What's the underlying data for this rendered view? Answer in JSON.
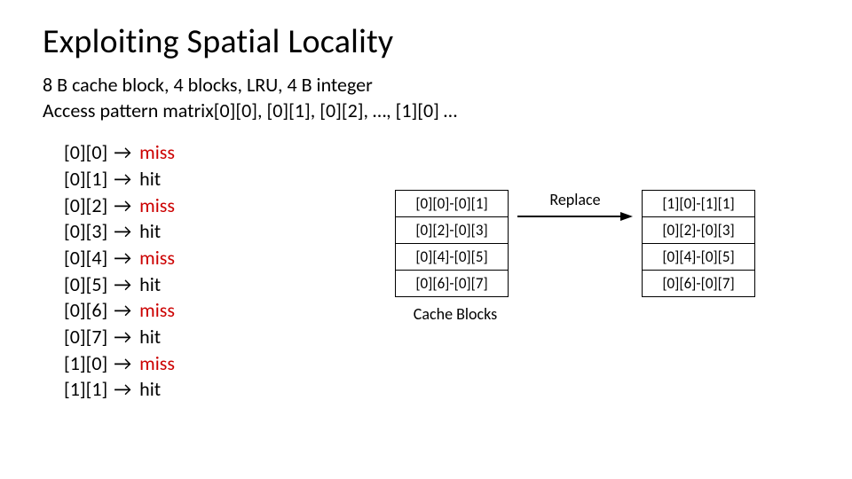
{
  "title": "Exploiting Spatial Locality",
  "subtitle_line1": "8 B cache block, 4 blocks, LRU, 4 B integer",
  "subtitle_line2": "Access pattern matrix[0][0], [0][1], [0][2], …, [1][0] …",
  "arrow_glyph": "→",
  "accesses": [
    {
      "idx": "[0][0]",
      "result": "miss",
      "cls": "miss"
    },
    {
      "idx": "[0][1]",
      "result": "hit",
      "cls": "hit"
    },
    {
      "idx": "[0][2]",
      "result": "miss",
      "cls": "miss"
    },
    {
      "idx": "[0][3]",
      "result": "hit",
      "cls": "hit"
    },
    {
      "idx": "[0][4]",
      "result": "miss",
      "cls": "miss"
    },
    {
      "idx": "[0][5]",
      "result": "hit",
      "cls": "hit"
    },
    {
      "idx": "[0][6]",
      "result": "miss",
      "cls": "miss"
    },
    {
      "idx": "[0][7]",
      "result": "hit",
      "cls": "hit"
    },
    {
      "idx": "[1][0]",
      "result": "miss",
      "cls": "miss"
    },
    {
      "idx": "[1][1]",
      "result": "hit",
      "cls": "hit"
    }
  ],
  "cache_before": [
    "[0][0]-[0][1]",
    "[0][2]-[0][3]",
    "[0][4]-[0][5]",
    "[0][6]-[0][7]"
  ],
  "cache_after": [
    "[1][0]-[1][1]",
    "[0][2]-[0][3]",
    "[0][4]-[0][5]",
    "[0][6]-[0][7]"
  ],
  "replace_label": "Replace",
  "cache_blocks_label": "Cache Blocks"
}
